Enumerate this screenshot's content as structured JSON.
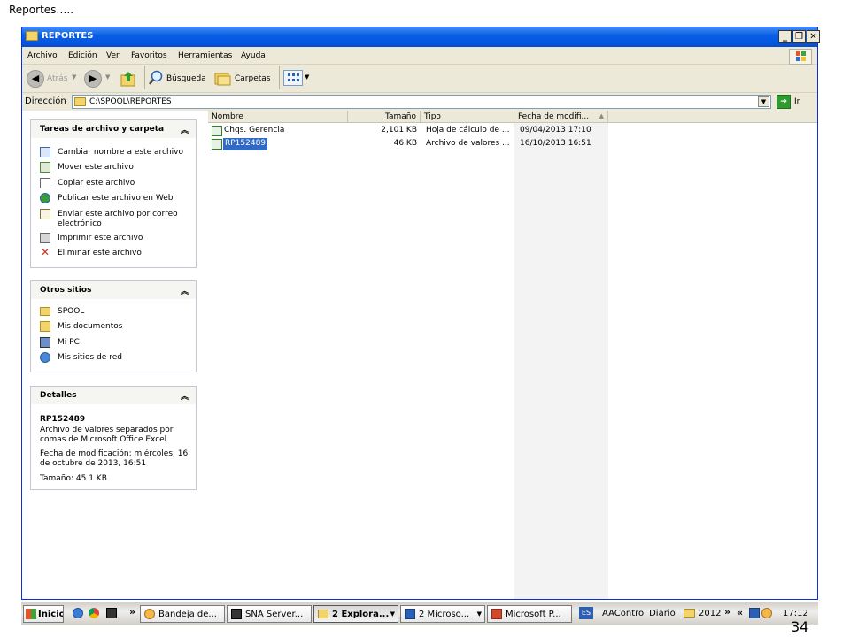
{
  "slide": {
    "title": "Reportes…..",
    "number": "34"
  },
  "window": {
    "title": "REPORTES",
    "menu": [
      "Archivo",
      "Edición",
      "Ver",
      "Favoritos",
      "Herramientas",
      "Ayuda"
    ],
    "toolbar": {
      "back": "Atrás",
      "search": "Búsqueda",
      "folders": "Carpetas"
    },
    "address": {
      "label": "Dirección",
      "value": "C:\\SPOOL\\REPORTES",
      "go": "Ir"
    }
  },
  "tasks_panel": {
    "title": "Tareas de archivo y carpeta",
    "items": [
      {
        "label": "Cambiar nombre a este archivo",
        "icon": "rename-icon"
      },
      {
        "label": "Mover este archivo",
        "icon": "move-icon"
      },
      {
        "label": "Copiar este archivo",
        "icon": "copy-icon"
      },
      {
        "label": "Publicar este archivo en Web",
        "icon": "globe-icon"
      },
      {
        "label": "Enviar este archivo por correo electrónico",
        "icon": "mail-icon"
      },
      {
        "label": "Imprimir este archivo",
        "icon": "printer-icon"
      },
      {
        "label": "Eliminar este archivo",
        "icon": "delete-icon"
      }
    ]
  },
  "places_panel": {
    "title": "Otros sitios",
    "items": [
      {
        "label": "SPOOL",
        "icon": "folder-icon"
      },
      {
        "label": "Mis documentos",
        "icon": "documents-icon"
      },
      {
        "label": "Mi PC",
        "icon": "computer-icon"
      },
      {
        "label": "Mis sitios de red",
        "icon": "network-icon"
      }
    ]
  },
  "details_panel": {
    "title": "Detalles",
    "name": "RP152489",
    "type": "Archivo de valores separados por comas de Microsoft Office Excel",
    "modified": "Fecha de modificación: miércoles, 16 de octubre de 2013, 16:51",
    "size": "Tamaño: 45.1 KB"
  },
  "file_list": {
    "columns": [
      "Nombre",
      "Tamaño",
      "Tipo",
      "Fecha de modifi..."
    ],
    "rows": [
      {
        "name": "Chqs. Gerencia",
        "size": "2,101 KB",
        "type": "Hoja de cálculo de ...",
        "date": "09/04/2013 17:10"
      },
      {
        "name": "RP152489",
        "size": "46 KB",
        "type": "Archivo de valores ...",
        "date": "16/10/2013 16:51"
      }
    ]
  },
  "taskbar": {
    "start": "Inicio",
    "buttons": [
      "Bandeja de...",
      "SNA Server...",
      "2 Explora...",
      "2 Microso...",
      "Microsoft P..."
    ],
    "lang": "ES",
    "extra": "AAControl Diario",
    "folder": "2012",
    "chevron": "»",
    "tray_chevron": "«",
    "clock": "17:12"
  },
  "colors": {
    "title_blue": "#0a5fe6",
    "selection": "#316ac5",
    "panel_border": "#c5c5d3"
  }
}
